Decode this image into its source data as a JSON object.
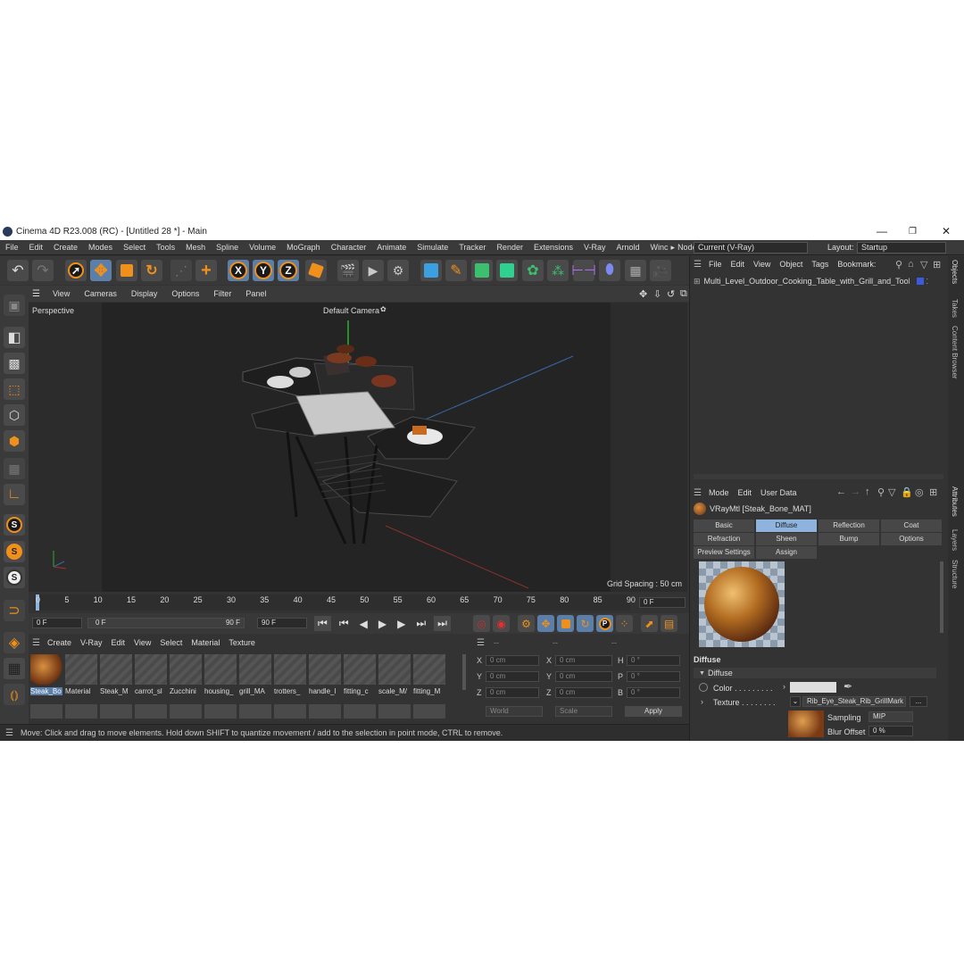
{
  "window": {
    "title": "Cinema 4D R23.008 (RC) - [Untitled 28 *] - Main",
    "controls": {
      "minimize": "—",
      "maximize": "❐",
      "close": "✕"
    }
  },
  "menu": {
    "items": [
      "File",
      "Edit",
      "Create",
      "Modes",
      "Select",
      "Tools",
      "Mesh",
      "Spline",
      "Volume",
      "MoGraph",
      "Character",
      "Animate",
      "Simulate",
      "Tracker",
      "Render",
      "Extensions",
      "V-Ray",
      "Arnold",
      "Winc"
    ],
    "more_arrow": "▸",
    "node_space_label": "Node Space:",
    "node_space_value": "Current (V-Ray)",
    "layout_label": "Layout:",
    "layout_value": "Startup"
  },
  "axis_buttons": [
    "X",
    "Y",
    "Z"
  ],
  "viewport": {
    "menu": [
      "View",
      "Cameras",
      "Display",
      "Options",
      "Filter",
      "Panel"
    ],
    "label": "Perspective",
    "camera": "Default Camera",
    "camera_icon": "✿",
    "grid_spacing": "Grid Spacing : 50 cm",
    "nav_icons": [
      "✥",
      "⇩",
      "↺",
      "⧉"
    ]
  },
  "timeline": {
    "ticks": [
      "0",
      "5",
      "10",
      "15",
      "20",
      "25",
      "30",
      "35",
      "40",
      "45",
      "50",
      "55",
      "60",
      "65",
      "70",
      "75",
      "80",
      "85",
      "90"
    ],
    "current_frame": "0 F"
  },
  "transport": {
    "start": "0 F",
    "range_start": "0 F",
    "range_end": "90 F",
    "end": "90 F"
  },
  "materials": {
    "menu": [
      "Create",
      "V-Ray",
      "Edit",
      "View",
      "Select",
      "Material",
      "Texture"
    ],
    "items": [
      "Steak_Bo",
      "Material",
      "Steak_M",
      "carrot_sl",
      "Zucchini",
      "housing_",
      "grill_MA",
      "trotters_",
      "handle_l",
      "fitting_c",
      "scale_M/",
      "fitting_M"
    ]
  },
  "coords": {
    "header": [
      "--",
      "--",
      "--"
    ],
    "rows": [
      {
        "a": "X",
        "av": "0 cm",
        "b": "X",
        "bv": "0 cm",
        "c": "H",
        "cv": "0 °"
      },
      {
        "a": "Y",
        "av": "0 cm",
        "b": "Y",
        "bv": "0 cm",
        "c": "P",
        "cv": "0 °"
      },
      {
        "a": "Z",
        "av": "0 cm",
        "b": "Z",
        "bv": "0 cm",
        "c": "B",
        "cv": "0 °"
      }
    ],
    "world": "World",
    "scale": "Scale",
    "apply": "Apply"
  },
  "status": "Move: Click and drag to move elements. Hold down SHIFT to quantize movement / add to the selection in point mode, CTRL to remove.",
  "objects": {
    "menu": [
      "File",
      "Edit",
      "View",
      "Object",
      "Tags",
      "Bookmark:"
    ],
    "item": "Multi_Level_Outdoor_Cooking_Table_with_Grill_and_Tools_g"
  },
  "attributes": {
    "menu": [
      "Mode",
      "Edit",
      "User Data"
    ],
    "material": "VRayMtl [Steak_Bone_MAT]",
    "tabs_row1": [
      "Basic",
      "Diffuse",
      "Reflection",
      "Coat"
    ],
    "tabs_row2": [
      "Refraction",
      "Sheen",
      "Bump",
      "Options"
    ],
    "tabs_row3": [
      "Preview Settings",
      "Assign"
    ],
    "section": "Diffuse",
    "subsection": "Diffuse",
    "color_label": "Color . . . . . . . . .",
    "texture_label": "Texture . . . . . . . .",
    "texture_value": "Rib_Eye_Steak_Rib_GrillMark",
    "texture_btn": "...",
    "sampling_label": "Sampling",
    "sampling_value": "MIP",
    "blur_label": "Blur Offset",
    "blur_value": "0 %"
  },
  "side_tabs": [
    "Objects",
    "Takes",
    "Content Browser",
    "Attributes",
    "Layers",
    "Structure"
  ]
}
